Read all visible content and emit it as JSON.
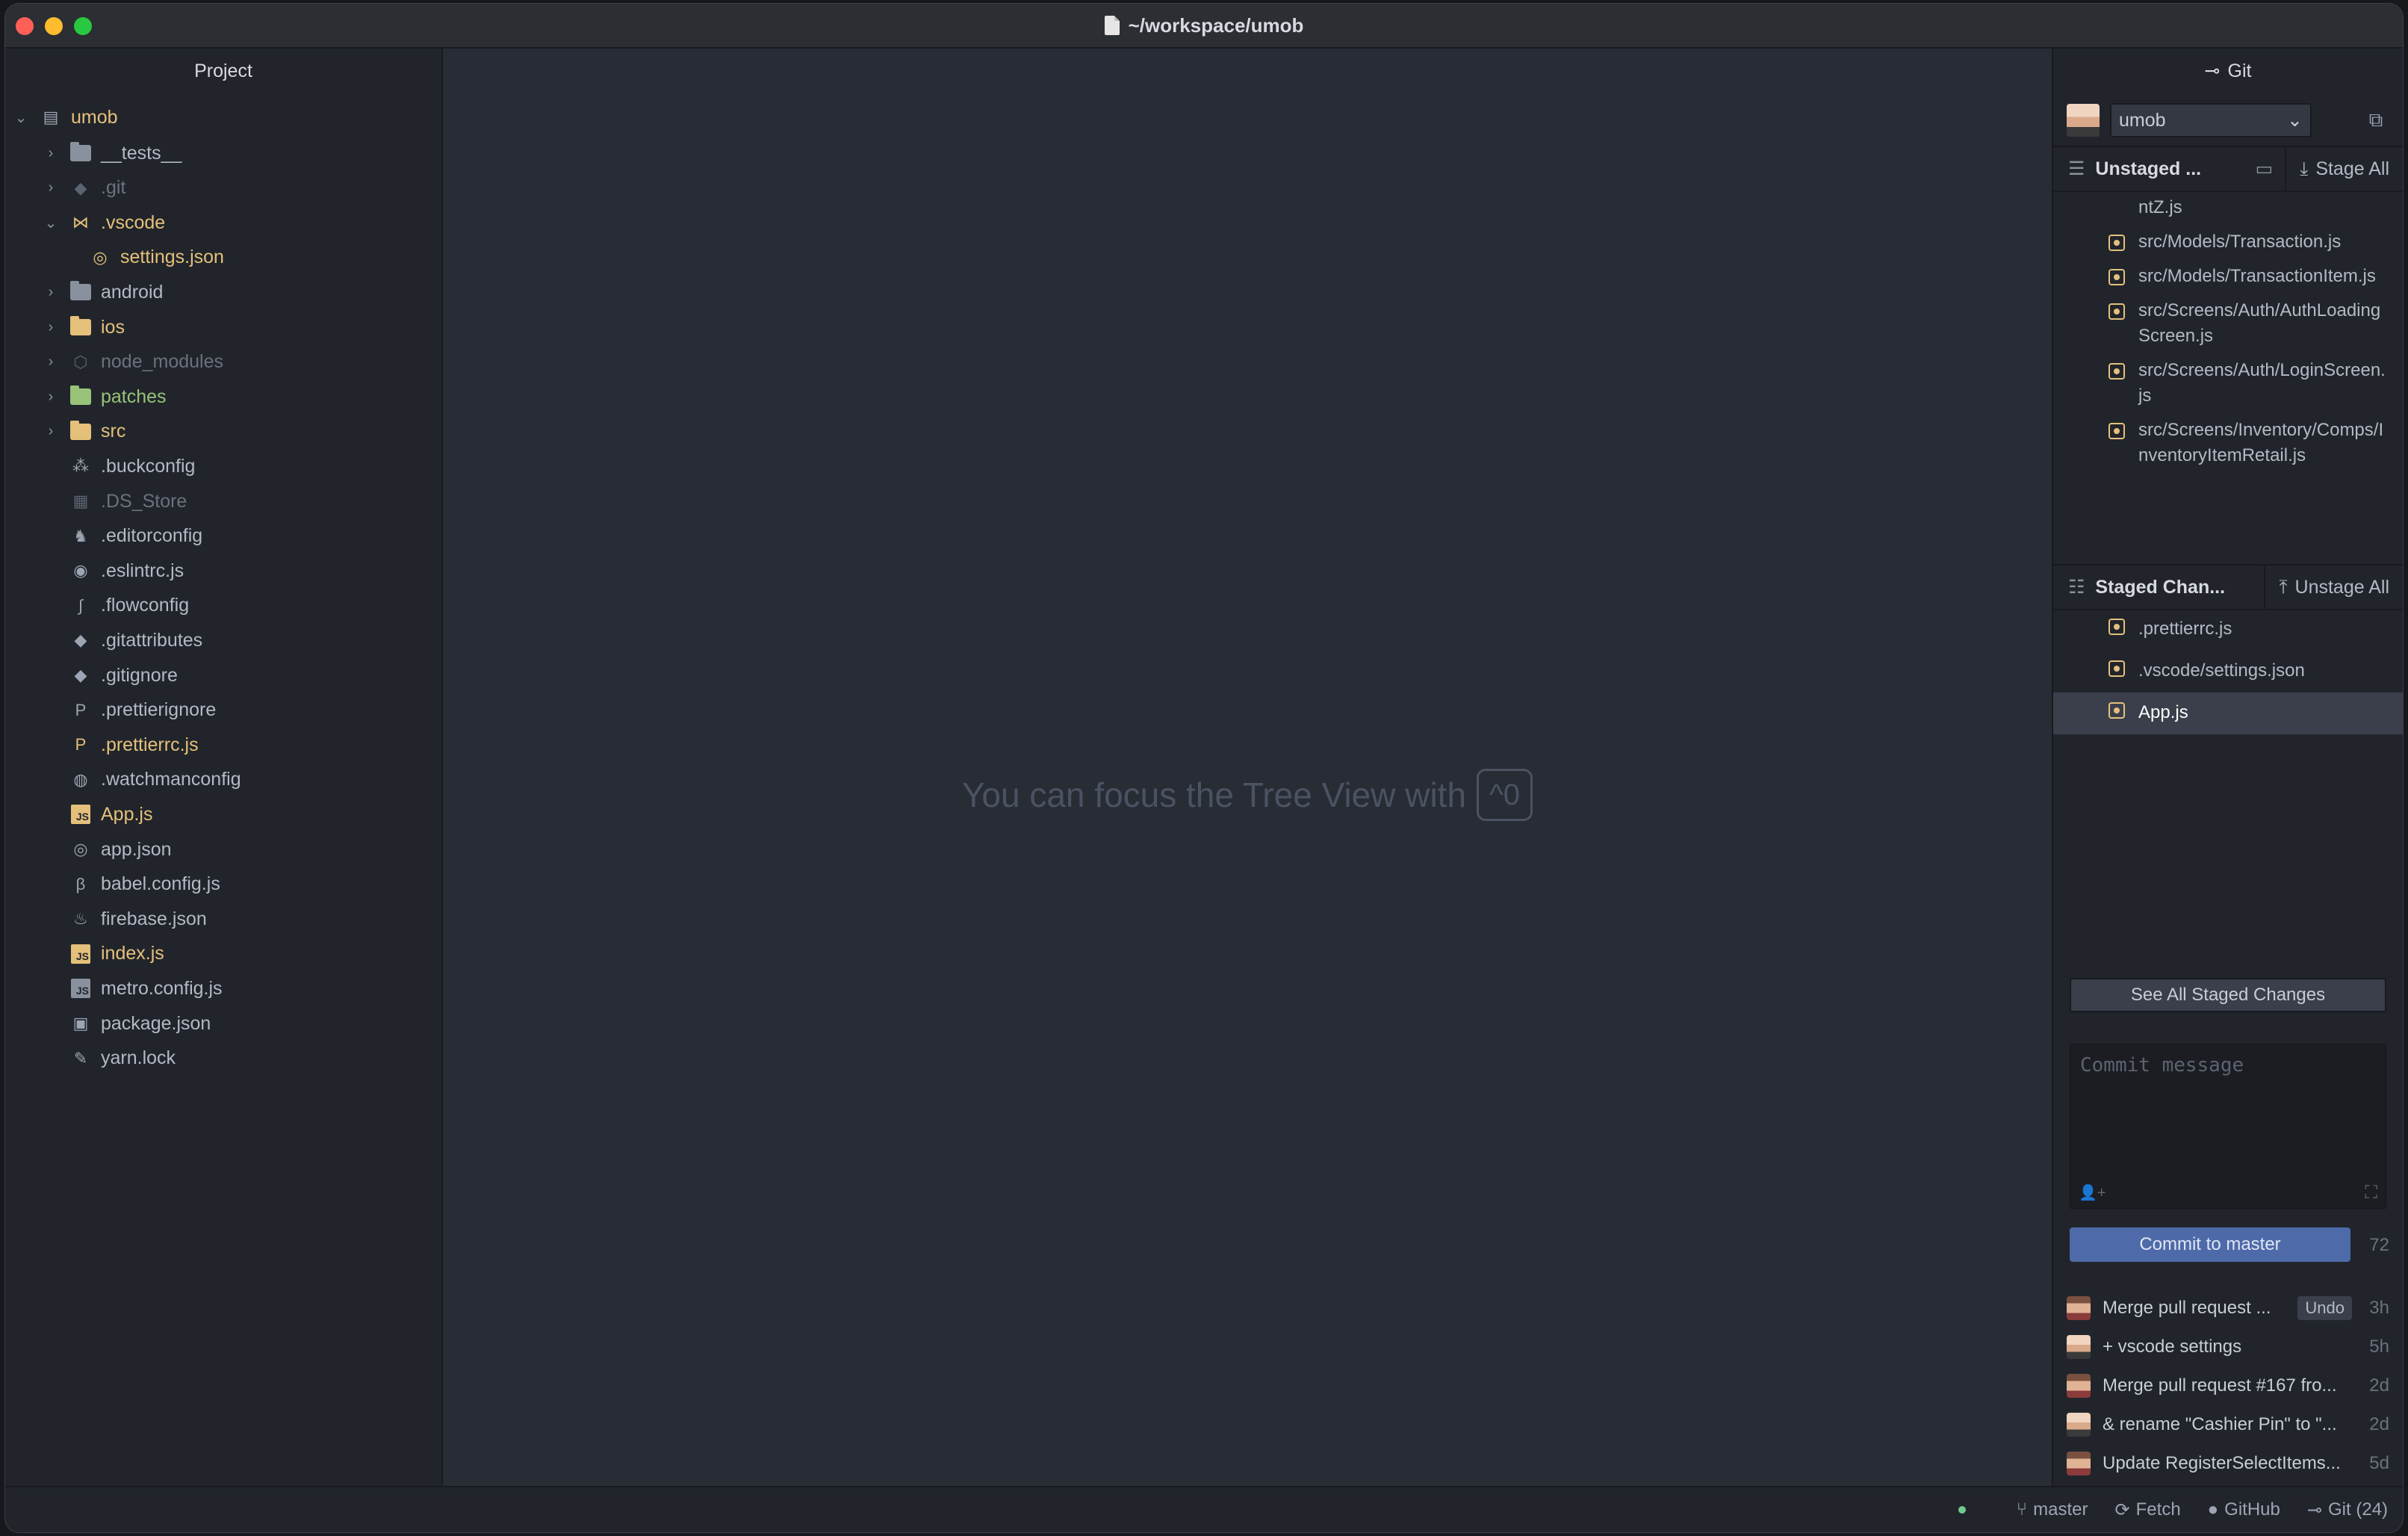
{
  "window": {
    "title": "~/workspace/umob"
  },
  "tree": {
    "header": "Project",
    "root": "umob",
    "items": [
      {
        "label": "__tests__",
        "type": "folder",
        "color": "norm",
        "expandable": true
      },
      {
        "label": ".git",
        "type": "git",
        "color": "dim",
        "expandable": true
      },
      {
        "label": ".vscode",
        "type": "vscode",
        "color": "yellow",
        "expandable": true,
        "expanded": true
      },
      {
        "label": "settings.json",
        "type": "json",
        "color": "yellow",
        "child": true
      },
      {
        "label": "android",
        "type": "folder",
        "color": "norm",
        "expandable": true
      },
      {
        "label": "ios",
        "type": "folder-yellow",
        "color": "yellow",
        "expandable": true
      },
      {
        "label": "node_modules",
        "type": "node",
        "color": "dim",
        "expandable": true
      },
      {
        "label": "patches",
        "type": "folder-green",
        "color": "green",
        "expandable": true
      },
      {
        "label": "src",
        "type": "folder-yellow",
        "color": "yellow",
        "expandable": true
      },
      {
        "label": ".buckconfig",
        "type": "buck",
        "color": "norm"
      },
      {
        "label": ".DS_Store",
        "type": "ds",
        "color": "dim"
      },
      {
        "label": ".editorconfig",
        "type": "editor",
        "color": "norm"
      },
      {
        "label": ".eslintrc.js",
        "type": "eslint",
        "color": "norm"
      },
      {
        "label": ".flowconfig",
        "type": "flow",
        "color": "norm"
      },
      {
        "label": ".gitattributes",
        "type": "git",
        "color": "norm"
      },
      {
        "label": ".gitignore",
        "type": "git",
        "color": "norm"
      },
      {
        "label": ".prettierignore",
        "type": "prettier",
        "color": "norm"
      },
      {
        "label": ".prettierrc.js",
        "type": "prettier",
        "color": "yellow"
      },
      {
        "label": ".watchmanconfig",
        "type": "watchman",
        "color": "norm"
      },
      {
        "label": "App.js",
        "type": "js",
        "color": "yellow"
      },
      {
        "label": "app.json",
        "type": "json",
        "color": "norm"
      },
      {
        "label": "babel.config.js",
        "type": "babel",
        "color": "norm"
      },
      {
        "label": "firebase.json",
        "type": "firebase",
        "color": "norm"
      },
      {
        "label": "index.js",
        "type": "js",
        "color": "yellow"
      },
      {
        "label": "metro.config.js",
        "type": "js-grey",
        "color": "norm"
      },
      {
        "label": "package.json",
        "type": "package",
        "color": "norm"
      },
      {
        "label": "yarn.lock",
        "type": "yarn",
        "color": "norm"
      }
    ]
  },
  "editor": {
    "hint": "You can focus the Tree View with",
    "shortcut": "^0"
  },
  "git": {
    "title": "Git",
    "repo": "umob",
    "unstaged": {
      "label": "Unstaged ...",
      "action": "Stage All",
      "files": [
        "ntZ.js",
        "src/Models/Transaction.js",
        "src/Models/TransactionItem.js",
        "src/Screens/Auth/AuthLoadingScreen.js",
        "src/Screens/Auth/LoginScreen.js",
        "src/Screens/Inventory/Comps/InventoryItemRetail.js"
      ]
    },
    "staged": {
      "label": "Staged Chan...",
      "action": "Unstage All",
      "files": [
        ".prettierrc.js",
        ".vscode/settings.json",
        "App.js"
      ],
      "see_all": "See All Staged Changes"
    },
    "commit": {
      "placeholder": "Commit message",
      "button": "Commit to master",
      "remaining": "72"
    },
    "recent": [
      {
        "msg": "Merge pull request ...",
        "undo": "Undo",
        "time": "3h"
      },
      {
        "msg": "+ vscode settings",
        "time": "5h"
      },
      {
        "msg": "Merge pull request #167 fro...",
        "time": "2d"
      },
      {
        "msg": "& rename \"Cashier Pin\" to \"...",
        "time": "2d"
      },
      {
        "msg": "Update RegisterSelectItems...",
        "time": "5d"
      }
    ]
  },
  "status": {
    "branch": "master",
    "fetch": "Fetch",
    "github": "GitHub",
    "git": "Git (24)"
  }
}
